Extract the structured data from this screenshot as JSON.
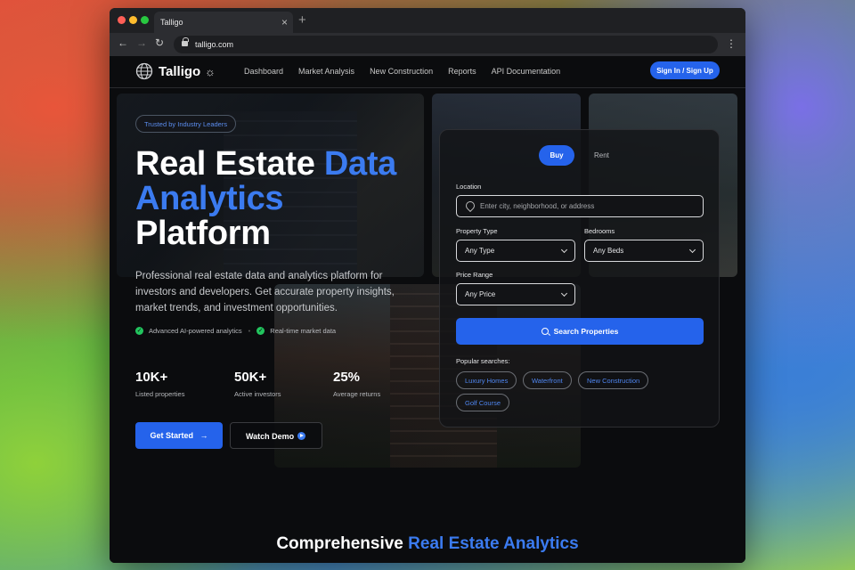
{
  "browser": {
    "tab_title": "Talligo",
    "tab_close": "×",
    "new_tab": "+",
    "url": "talligo.com",
    "back": "←",
    "forward": "→",
    "reload": "↻",
    "menu": "⋮"
  },
  "nav": {
    "brand": "Talligo",
    "theme_icon": "☼",
    "links": [
      "Dashboard",
      "Market Analysis",
      "New Construction",
      "Reports",
      "API Documentation"
    ],
    "signin": "Sign In / Sign Up"
  },
  "hero": {
    "badge": "Trusted by Industry Leaders",
    "title_line1_white": "Real Estate ",
    "title_line1_blue": "Data",
    "title_line2_blue": "Analytics",
    "title_line3_white": "Platform",
    "description": "Professional real estate data and analytics platform for investors and developers. Get accurate property insights, market trends, and investment opportunities.",
    "features": [
      "Advanced AI-powered analytics",
      "Real-time market data"
    ],
    "stats": [
      {
        "value": "10K+",
        "label": "Listed properties"
      },
      {
        "value": "50K+",
        "label": "Active investors"
      },
      {
        "value": "25%",
        "label": "Average returns"
      }
    ],
    "cta_primary": "Get Started",
    "cta_primary_arrow": "→",
    "cta_secondary": "Watch Demo"
  },
  "search": {
    "tabs": [
      "Buy",
      "Rent"
    ],
    "location_label": "Location",
    "location_placeholder": "Enter city, neighborhood, or address",
    "property_type_label": "Property Type",
    "property_type_value": "Any Type",
    "bedrooms_label": "Bedrooms",
    "bedrooms_value": "Any Beds",
    "price_label": "Price Range",
    "price_value": "Any Price",
    "button": "Search Properties",
    "popular_label": "Popular searches:",
    "popular": [
      "Luxury Homes",
      "Waterfront",
      "New Construction",
      "Golf Course"
    ]
  },
  "section": {
    "title_white": "Comprehensive ",
    "title_blue": "Real Estate Analytics"
  },
  "colors": {
    "accent": "#2563eb",
    "accent_text": "#3b7bf0",
    "background": "#0b0c0e",
    "check": "#22c55e"
  }
}
